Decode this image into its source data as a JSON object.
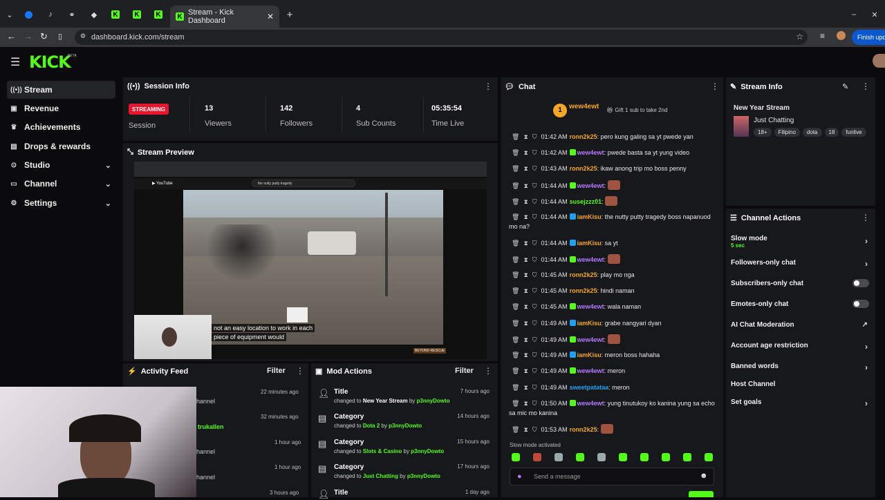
{
  "browser": {
    "tab_title": "Stream - Kick Dashboard",
    "url": "dashboard.kick.com/stream",
    "update_button": "Finish upda",
    "new_tab": "+"
  },
  "header": {
    "logo": "KICK",
    "beta": "BETA"
  },
  "sidebar": {
    "items": [
      {
        "label": "Stream",
        "icon": "radio-icon",
        "expandable": false
      },
      {
        "label": "Revenue",
        "icon": "dollar-icon",
        "expandable": false
      },
      {
        "label": "Achievements",
        "icon": "trophy-icon",
        "expandable": false
      },
      {
        "label": "Drops & rewards",
        "icon": "gift-icon",
        "expandable": false
      },
      {
        "label": "Studio",
        "icon": "studio-icon",
        "expandable": true
      },
      {
        "label": "Channel",
        "icon": "channel-icon",
        "expandable": true
      },
      {
        "label": "Settings",
        "icon": "gear-icon",
        "expandable": true
      }
    ]
  },
  "session": {
    "title": "Session Info",
    "status": "STREAMING",
    "status_label": "Session",
    "stats": [
      {
        "value": "13",
        "label": "Viewers"
      },
      {
        "value": "142",
        "label": "Followers"
      },
      {
        "value": "4",
        "label": "Sub Counts"
      },
      {
        "value": "05:35:54",
        "label": "Time Live"
      }
    ]
  },
  "preview": {
    "title": "Stream Preview",
    "search_text": "the nutty putty tragedy",
    "caption_line1": "not an easy location to work in each",
    "caption_line2": "piece of equipment would",
    "badge": "BEYOND RESCUE"
  },
  "activity": {
    "title": "Activity Feed",
    "filter": "Filter",
    "items": [
      {
        "text": "hannel",
        "time": "22 minutes ago"
      },
      {
        "text": "trukallen",
        "time": "32 minutes ago"
      },
      {
        "text": "hannel",
        "time": "1 hour ago"
      },
      {
        "text": "hannel",
        "time": "1 hour ago"
      },
      {
        "text": "",
        "time": "3 hours ago"
      }
    ]
  },
  "mod_actions": {
    "title": "Mod Actions",
    "filter": "Filter",
    "items": [
      {
        "title": "Title",
        "pre": "changed to ",
        "value": "New Year Stream",
        "mid": " by ",
        "user": "p3nnyDowto",
        "time": "7 hours ago"
      },
      {
        "title": "Category",
        "pre": "changed to ",
        "value": "Dota 2",
        "mid": " by ",
        "user": "p3nnyDowto",
        "time": "14 hours ago"
      },
      {
        "title": "Category",
        "pre": "changed to ",
        "value": "Slots & Casino",
        "mid": " by ",
        "user": "p3nnyDowto",
        "time": "15 hours ago"
      },
      {
        "title": "Category",
        "pre": "changed to ",
        "value": "Just Chatting",
        "mid": " by ",
        "user": "p3nnyDowto",
        "time": "17 hours ago"
      },
      {
        "title": "Title",
        "pre": "",
        "value": "",
        "mid": "",
        "user": "",
        "time": "1 day ago"
      }
    ]
  },
  "chat": {
    "title": "Chat",
    "top_user": "wew4ewt",
    "top_count": "1",
    "gift_text": "Gift 1 sub to take 2nd",
    "slow_mode_notice": "Slow mode activated",
    "placeholder": "Send a message",
    "messages": [
      {
        "time": "01:42 AM",
        "user": "ronn2k25",
        "color": "#f5a623",
        "badge": "",
        "text": "pero kung galing sa yt pwede yan"
      },
      {
        "time": "01:42 AM",
        "user": "wew4ewt",
        "color": "#b57aff",
        "badge": "green",
        "text": "pwede basta sa yt yung video"
      },
      {
        "time": "01:43 AM",
        "user": "ronn2k25",
        "color": "#f5a623",
        "badge": "",
        "text": "ikaw anong trip mo boss penny"
      },
      {
        "time": "01:44 AM",
        "user": "wew4ewt",
        "color": "#b57aff",
        "badge": "green",
        "text": ""
      },
      {
        "time": "01:44 AM",
        "user": "susejzzz01",
        "color": "#53fc18",
        "badge": "",
        "text": ""
      },
      {
        "time": "01:44 AM",
        "user": "iamKisu",
        "color": "#f5a623",
        "badge": "blue",
        "text": "the nutty putty tragedy boss napanuod mo na?"
      },
      {
        "time": "01:44 AM",
        "user": "iamKisu",
        "color": "#f5a623",
        "badge": "blue",
        "text": "sa yt"
      },
      {
        "time": "01:44 AM",
        "user": "wew4ewt",
        "color": "#b57aff",
        "badge": "green",
        "text": ""
      },
      {
        "time": "01:45 AM",
        "user": "ronn2k25",
        "color": "#f5a623",
        "badge": "",
        "text": "play mo nga"
      },
      {
        "time": "01:45 AM",
        "user": "ronn2k25",
        "color": "#f5a623",
        "badge": "",
        "text": "hindi naman"
      },
      {
        "time": "01:45 AM",
        "user": "wew4ewt",
        "color": "#b57aff",
        "badge": "green",
        "text": "wala naman"
      },
      {
        "time": "01:49 AM",
        "user": "iamKisu",
        "color": "#f5a623",
        "badge": "blue",
        "text": "grabe nangyari dyan"
      },
      {
        "time": "01:49 AM",
        "user": "wew4ewt",
        "color": "#b57aff",
        "badge": "green",
        "text": ""
      },
      {
        "time": "01:49 AM",
        "user": "iamKisu",
        "color": "#f5a623",
        "badge": "blue",
        "text": "meron boss hahaha"
      },
      {
        "time": "01:49 AM",
        "user": "wew4ewt",
        "color": "#b57aff",
        "badge": "green",
        "text": "meron"
      },
      {
        "time": "01:49 AM",
        "user": "sweetpatataa",
        "color": "#1da1f2",
        "badge": "",
        "text": "meron"
      },
      {
        "time": "01:50 AM",
        "user": "wew4ewt",
        "color": "#b57aff",
        "badge": "green",
        "text": "yung tinutukoy ko kanina yung sa echo sa mic mo kanina"
      },
      {
        "time": "01:53 AM",
        "user": "ronn2k25",
        "color": "#f5a623",
        "badge": "",
        "text": ""
      }
    ]
  },
  "stream_info": {
    "title": "Stream Info",
    "stream_title": "New Year Stream",
    "category": "Just Chatting",
    "tags": [
      "18+",
      "Filipino",
      "dota",
      "18",
      "funlive"
    ]
  },
  "channel_actions": {
    "title": "Channel Actions",
    "slow_mode": "Slow mode",
    "slow_mode_value": "5 sec",
    "rows": [
      {
        "label": "Followers-only chat",
        "control": "chevron"
      },
      {
        "label": "Subscribers-only chat",
        "control": "toggle"
      },
      {
        "label": "Emotes-only chat",
        "control": "toggle"
      },
      {
        "label": "AI Chat Moderation",
        "control": "link"
      },
      {
        "label": "Account age restriction",
        "control": "chevron"
      },
      {
        "label": "Banned words",
        "control": "chevron"
      },
      {
        "label": "Host Channel",
        "control": "none"
      },
      {
        "label": "Set goals",
        "control": "chevron"
      }
    ]
  },
  "colors": {
    "accent": "#53fc18",
    "streaming_badge": "#e5162d",
    "panel": "#17181c"
  }
}
